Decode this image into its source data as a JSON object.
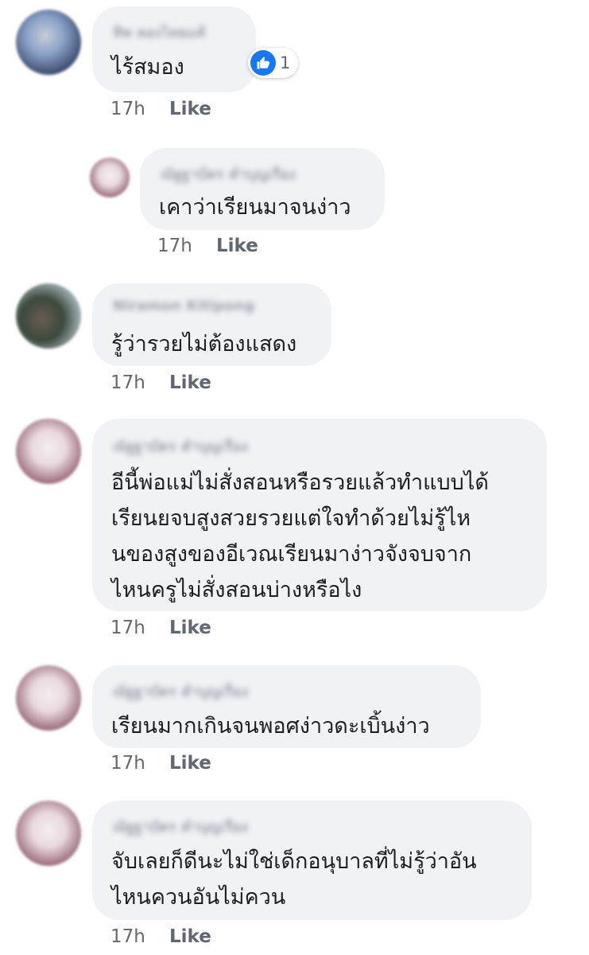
{
  "comments": [
    {
      "author": "ทิพ คองไทยแท้",
      "text": "ไร้สมอง",
      "time": "17h",
      "like_label": "Like",
      "reaction_count": "1",
      "reaction_icon": "thumbs-up-icon",
      "avatar_colors": [
        "#3a4a6b",
        "#c9cdd6",
        "#8aa2c8"
      ]
    },
    {
      "author": "ณัฐฐาบัตร คำบุญเรือง",
      "text": "เคาว่าเรียนมาจนง่าว",
      "time": "17h",
      "like_label": "Like",
      "avatar_colors": [
        "#e9d9de",
        "#8f5b6b",
        "#f3eef0"
      ]
    },
    {
      "author": "Niramon Kitipong",
      "text": "รู้ว่ารวยไม่ต้องแสดง",
      "time": "17h",
      "like_label": "Like",
      "avatar_colors": [
        "#3b4a3c",
        "#c6d3e0",
        "#6a5c52"
      ]
    },
    {
      "author": "ณัฐฐาบัตร คำบุญเรือง",
      "text": "อีนี้พ่อแม่ไม่สั่งสอนหรือรวยแล้วทำแบบได้\nเรียนยจบสูงสวยรวยแต่ใจทำด้วยไม่รู้ไห\nนของสูงของอีเวณเรียนมาง่าวจังจบจาก\nไหนครูไม่สั่งสอนบ่างหรือไง",
      "time": "17h",
      "like_label": "Like",
      "avatar_colors": [
        "#e9d9de",
        "#8f5b6b",
        "#f3eef0"
      ]
    },
    {
      "author": "ณัฐฐาบัตร คำบุญเรือง",
      "text": "เรียนมากเกินจนพอศง่าวดะเบิ้นง่าว",
      "time": "17h",
      "like_label": "Like",
      "avatar_colors": [
        "#e9d9de",
        "#8f5b6b",
        "#f3eef0"
      ]
    },
    {
      "author": "ณัฐฐาบัตร คำบุญเรือง",
      "text": "จับเลยก็ดีนะไม่ใช่เด็กอนุบาลที่ไม่รู้ว่าอัน\nไหนควนอันไม่ควน",
      "time": "17h",
      "like_label": "Like",
      "avatar_colors": [
        "#e9d9de",
        "#8f5b6b",
        "#f3eef0"
      ]
    }
  ]
}
